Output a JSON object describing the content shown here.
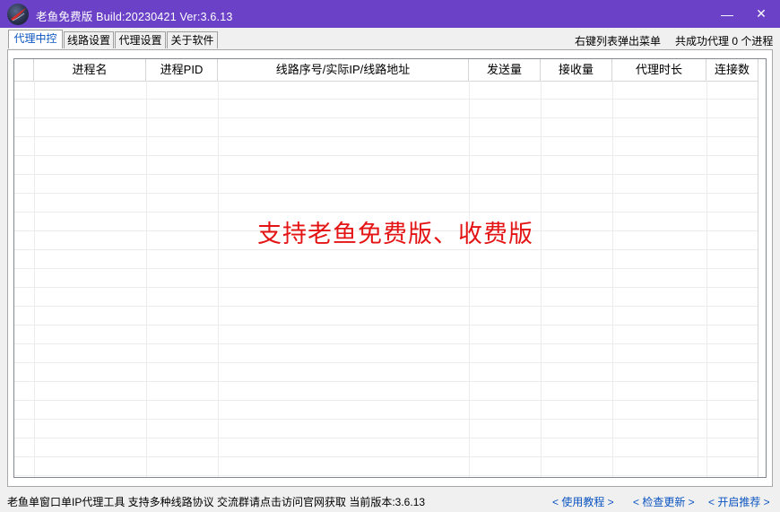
{
  "window": {
    "title": "老鱼免费版 Build:20230421 Ver:3.6.13",
    "minimize_glyph": "—",
    "close_glyph": "✕",
    "logo_icon": "app-logo-icon"
  },
  "tabs": [
    {
      "label": "代理中控",
      "active": true
    },
    {
      "label": "线路设置",
      "active": false
    },
    {
      "label": "代理设置",
      "active": false
    },
    {
      "label": "关于软件",
      "active": false
    }
  ],
  "top_right": {
    "hint": "右键列表弹出菜单",
    "proxy_count": "共成功代理 0 个进程"
  },
  "table": {
    "columns": [
      "进程名",
      "进程PID",
      "线路序号/实际IP/线路地址",
      "发送量",
      "接收量",
      "代理时长",
      "连接数"
    ],
    "rows": []
  },
  "watermark": "支持老鱼免费版、收费版",
  "status": {
    "text": "老鱼单窗口单IP代理工具 支持多种线路协议 交流群请点击访问官网获取  当前版本:3.6.13",
    "links": [
      "< 使用教程 >",
      "< 检查更新 >",
      "< 开启推荐 >"
    ]
  },
  "colors": {
    "titlebar": "#6b41c8",
    "accent": "#0b54c0",
    "watermark": "#e41414"
  }
}
